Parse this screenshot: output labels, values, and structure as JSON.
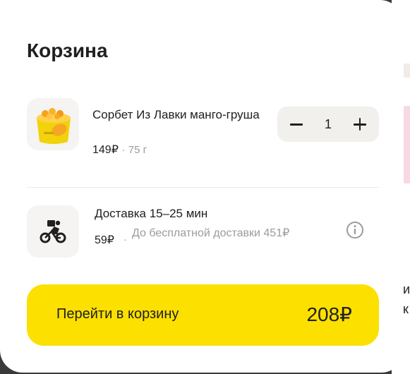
{
  "cart": {
    "title": "Корзина",
    "item": {
      "name": "Сорбет Из Лавки манго-груша",
      "price": "149₽",
      "separator": "·",
      "weight": "75 г",
      "quantity": "1",
      "image": "sorbet-cup-image"
    },
    "delivery": {
      "title": "Доставка 15–25 мин",
      "price": "59₽",
      "separator": "·",
      "note": "До бесплатной доставки 451₽",
      "icon": "courier-bike-icon",
      "info_icon": "info-icon"
    },
    "checkout": {
      "label": "Перейти в корзину",
      "total": "208₽"
    }
  },
  "background": {
    "char1": "и",
    "char2": "к"
  },
  "colors": {
    "accent": "#fce000",
    "text": "#21201f",
    "muted": "#9e9b98",
    "surface": "#f1f0ed"
  }
}
